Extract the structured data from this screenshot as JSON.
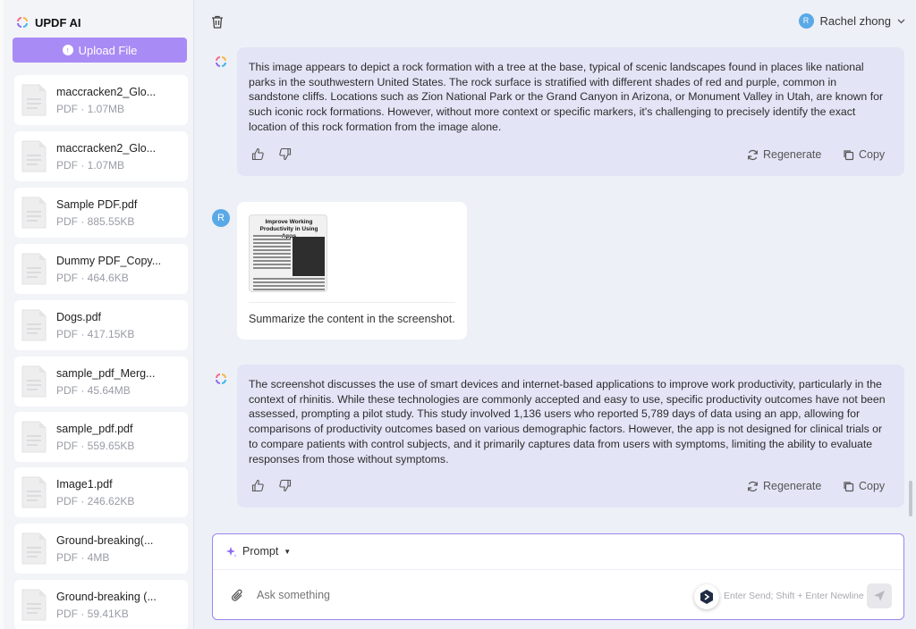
{
  "app": {
    "name": "UPDF AI"
  },
  "sidebar": {
    "upload_label": "Upload File",
    "files": [
      {
        "name": "maccracken2_Glo...",
        "size": "PDF · 1.07MB"
      },
      {
        "name": "maccracken2_Glo...",
        "size": "PDF · 1.07MB"
      },
      {
        "name": "Sample PDF.pdf",
        "size": "PDF · 885.55KB"
      },
      {
        "name": "Dummy PDF_Copy...",
        "size": "PDF · 464.6KB"
      },
      {
        "name": "Dogs.pdf",
        "size": "PDF · 417.15KB"
      },
      {
        "name": "sample_pdf_Merg...",
        "size": "PDF · 45.64MB"
      },
      {
        "name": "sample_pdf.pdf",
        "size": "PDF · 559.65KB"
      },
      {
        "name": "Image1.pdf",
        "size": "PDF · 246.62KB"
      },
      {
        "name": "Ground-breaking(...",
        "size": "PDF · 4MB"
      },
      {
        "name": "Ground-breaking (...",
        "size": "PDF · 59.41KB"
      }
    ]
  },
  "header": {
    "user_name": "Rachel zhong",
    "user_initial": "R"
  },
  "chat": {
    "messages": [
      {
        "role": "ai",
        "text": "This image appears to depict a rock formation with a tree at the base, typical of scenic landscapes found in places like national parks in the southwestern United States. The rock surface is stratified with different shades of red and purple, common in sandstone cliffs. Locations such as Zion National Park or the Grand Canyon in Arizona, or Monument Valley in Utah, are known for such iconic rock formations. However, without more context or specific markers, it's challenging to precisely identify the exact location of this rock formation from the image alone."
      },
      {
        "role": "user",
        "initial": "R",
        "attachment_title": "Improve Working Productivity in Using Apps",
        "text": "Summarize the content in the screenshot."
      },
      {
        "role": "ai",
        "text": "The screenshot discusses the use of smart devices and internet-based applications to improve work productivity, particularly in the context of rhinitis. While these technologies are commonly accepted and easy to use, specific productivity outcomes have not been assessed, prompting a pilot study. This study involved 1,136 users who reported 5,789 days of data using an app, allowing for comparisons of productivity outcomes based on various demographic factors. However, the app is not designed for clinical trials or to compare patients with control subjects, and it primarily captures data from users with symptoms, limiting the ability to evaluate responses from those without symptoms."
      }
    ],
    "regenerate_label": "Regenerate",
    "copy_label": "Copy"
  },
  "input": {
    "prompt_label": "Prompt",
    "placeholder": "Ask something",
    "hint": "Enter Send; Shift + Enter Newline"
  },
  "colors": {
    "accent": "#a98bf5",
    "ai_bubble": "#e3e4f6",
    "input_border": "#9b86ef"
  }
}
